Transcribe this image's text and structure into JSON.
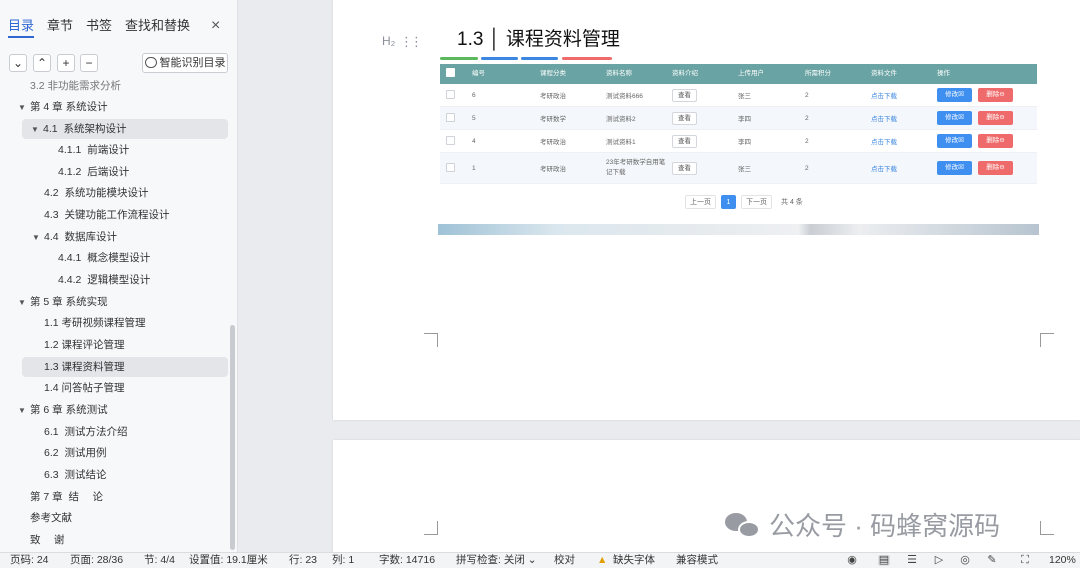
{
  "sidebar": {
    "tabs": [
      "目录",
      "章节",
      "书签",
      "查找和替换"
    ],
    "close": "×",
    "tools": [
      "⌄",
      "⌃",
      "+",
      "−"
    ],
    "smart_button": "智能识别目录",
    "toc": [
      {
        "num": "3.2",
        "text": "非功能需求分析"
      },
      {
        "num": "第 4 章",
        "text": "系统设计"
      },
      {
        "num": "4.1",
        "text": "系统架构设计"
      },
      {
        "num": "4.1.1",
        "text": "前端设计"
      },
      {
        "num": "4.1.2",
        "text": "后端设计"
      },
      {
        "num": "4.2",
        "text": "系统功能模块设计"
      },
      {
        "num": "4.3",
        "text": "关键功能工作流程设计"
      },
      {
        "num": "4.4",
        "text": "数据库设计"
      },
      {
        "num": "4.4.1",
        "text": "概念模型设计"
      },
      {
        "num": "4.4.2",
        "text": "逻辑模型设计"
      },
      {
        "num": "第 5 章",
        "text": "系统实现"
      },
      {
        "num": "1.1",
        "text": "考研视频课程管理"
      },
      {
        "num": "1.2",
        "text": "课程评论管理"
      },
      {
        "num": "1.3",
        "text": "课程资料管理"
      },
      {
        "num": "1.4",
        "text": "问答帖子管理"
      },
      {
        "num": "第 6 章",
        "text": "系统测试"
      },
      {
        "num": "6.1",
        "text": "测试方法介绍"
      },
      {
        "num": "6.2",
        "text": "测试用例"
      },
      {
        "num": "6.3",
        "text": "测试结论"
      },
      {
        "num": "第 7 章",
        "text": "结　 论"
      },
      {
        "num": "",
        "text": "参考文献"
      },
      {
        "num": "",
        "text": "致　 谢"
      }
    ]
  },
  "document": {
    "heading_marker": "H₂",
    "heading": "1.3 │ 课程资料管理",
    "accent_colors": [
      "#5cb85c",
      "#3a86e0",
      "#3a86e0",
      "#ef6b6b"
    ],
    "table": {
      "headers": [
        "编号",
        "课程分类",
        "资料名称",
        "资料介绍",
        "上传用户",
        "所需积分",
        "资料文件",
        "操作"
      ],
      "view_label": "查看",
      "download_label": "点击下载",
      "edit_label": "修改☒",
      "delete_label": "删除⊖",
      "rows": [
        {
          "id": "6",
          "category": "考研政治",
          "name": "测试资料666",
          "user": "张三",
          "points": "2"
        },
        {
          "id": "5",
          "category": "考研数学",
          "name": "测试资料2",
          "user": "李四",
          "points": "2"
        },
        {
          "id": "4",
          "category": "考研政治",
          "name": "测试资料1",
          "user": "李四",
          "points": "2"
        },
        {
          "id": "1",
          "category": "考研政治",
          "name": "23年考研数学自用笔记下载",
          "user": "张三",
          "points": "2"
        }
      ]
    },
    "pager": {
      "prev": "上一页",
      "current": "1",
      "next": "下一页",
      "total": "共 4 条"
    }
  },
  "watermark": "公众号 · 码蜂窝源码",
  "statusbar": {
    "page_num": "页码: 24",
    "pages": "页面: 28/36",
    "section": "节: 4/4",
    "setting": "设置值: 19.1厘米",
    "line": "行: 23",
    "col": "列: 1",
    "words": "字数: 14716",
    "spell": "拼写检查: 关闭 ⌄",
    "proof": "校对",
    "missing_font": "缺失字体",
    "compat": "兼容模式",
    "zoom": "120%"
  },
  "colors": {
    "accent": "#2e67d1",
    "table_header": "#6aa3a3",
    "edit": "#3f8ff0",
    "delete": "#ef6b6b"
  }
}
